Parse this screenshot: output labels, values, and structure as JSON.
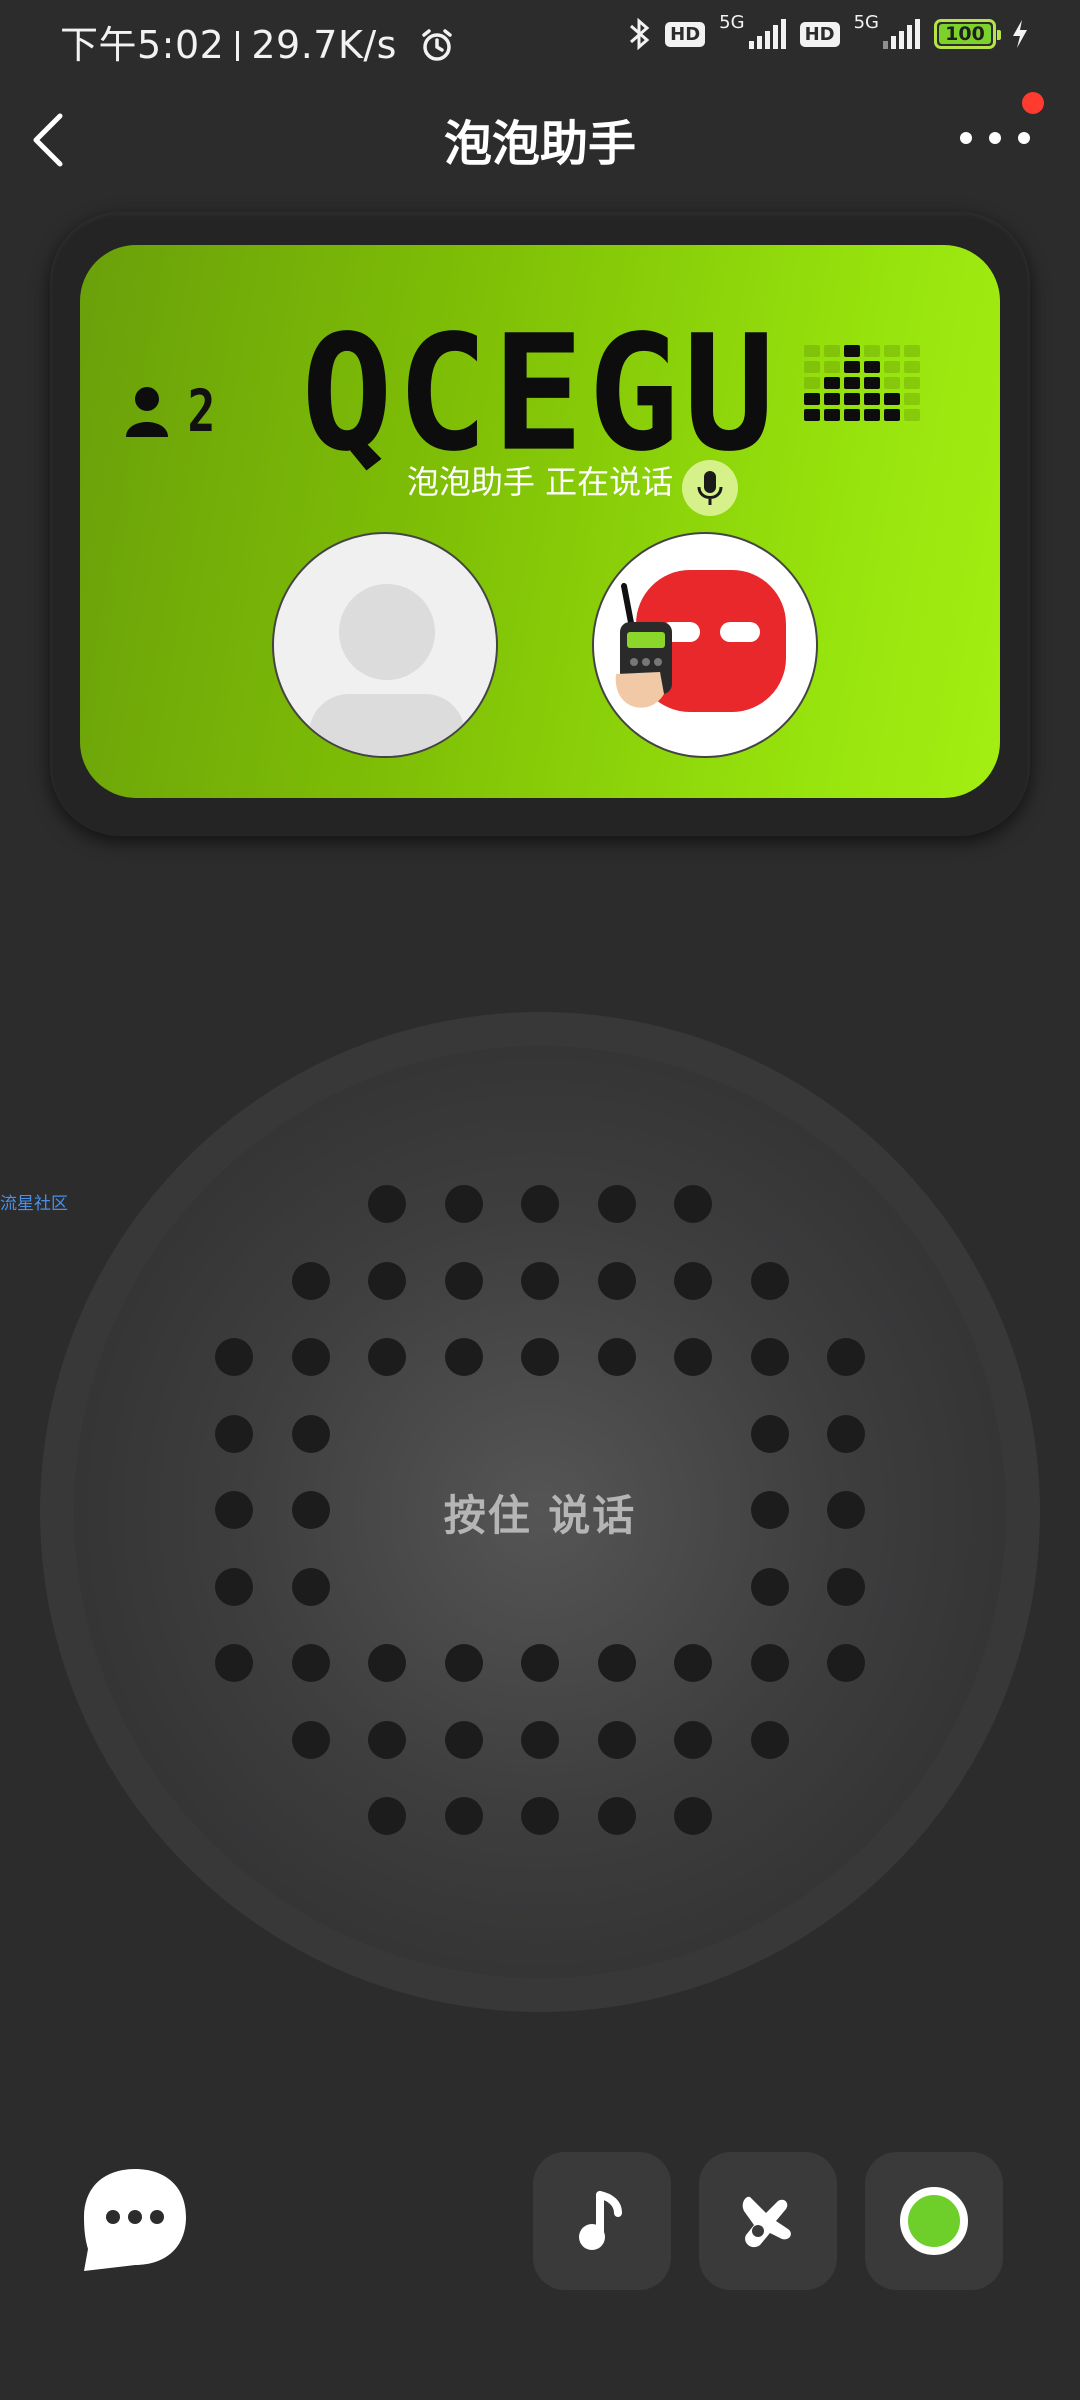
{
  "status_bar": {
    "time": "下午5:02",
    "speed": "29.7K/s",
    "hd1": "HD",
    "net1": "5G",
    "hd2": "HD",
    "net2": "5G",
    "battery": "100"
  },
  "header": {
    "title": "泡泡助手"
  },
  "device": {
    "user_count": "2",
    "channel_code": "QCEGU",
    "speaking_status": "泡泡助手 正在说话"
  },
  "speaker": {
    "talk_label": "按住 说话"
  },
  "side_link": "流星社区",
  "colors": {
    "background": "#2c2c2d",
    "screen_start": "#6aa00a",
    "screen_end": "#a3ef12",
    "accent_green": "#6fcf2a",
    "notification_red": "#ff3b30"
  },
  "icons": {
    "back": "chevron-left-icon",
    "more": "more-dots-icon",
    "chat": "chat-bubble-icon",
    "music": "music-note-icon",
    "gesture": "hand-gesture-icon",
    "record": "record-icon",
    "mic": "microphone-icon",
    "person": "person-icon"
  }
}
